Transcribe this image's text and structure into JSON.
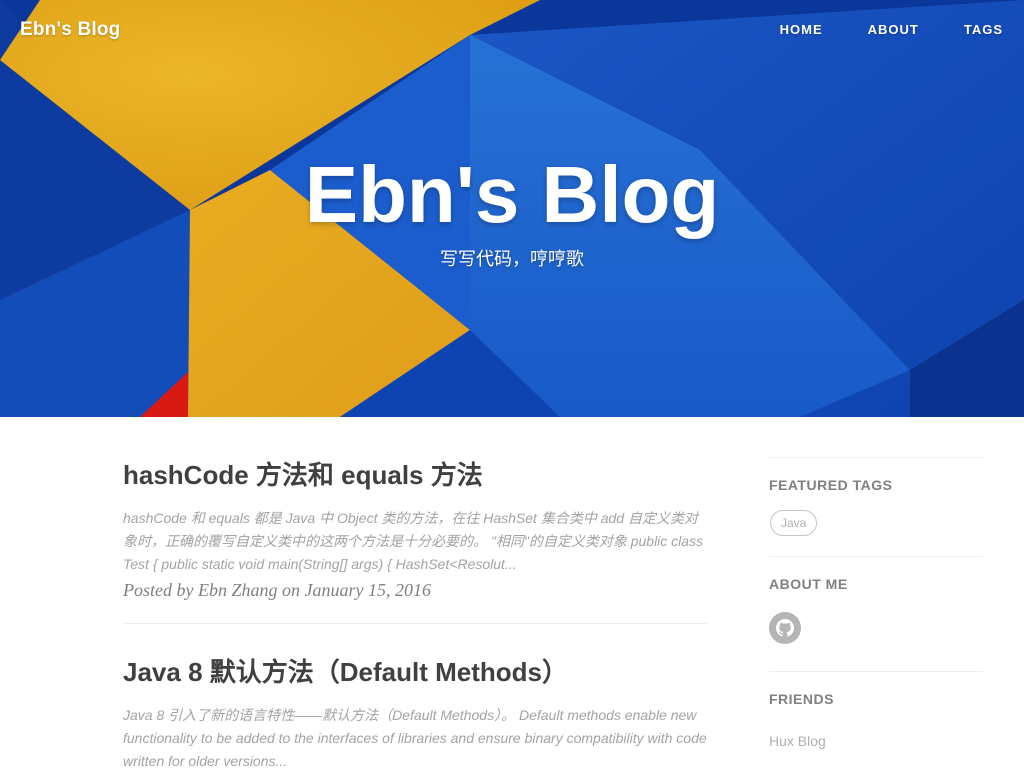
{
  "site": {
    "brand": "Ebn's Blog",
    "nav": [
      {
        "label": "HOME"
      },
      {
        "label": "ABOUT"
      },
      {
        "label": "TAGS"
      }
    ],
    "hero_title": "Ebn's Blog",
    "hero_subtitle": "写写代码，哼哼歌"
  },
  "posts": [
    {
      "title": "hashCode 方法和 equals 方法",
      "excerpt": "hashCode 和 equals 都是 Java 中 Object 类的方法，在往 HashSet 集合类中 add 自定义类对象时，正确的覆写自定义类中的这两个方法是十分必要的。 \"相同\"的自定义类对象 public class Test { public static void main(String[] args) { HashSet<Resolut...",
      "meta": "Posted by Ebn Zhang on January 15, 2016"
    },
    {
      "title": "Java 8 默认方法（Default Methods）",
      "excerpt": "Java 8 引入了新的语言特性——默认方法（Default Methods）。 Default methods enable new functionality to be added to the interfaces of libraries and ensure binary compatibility with code written for older versions..."
    }
  ],
  "sidebar": {
    "featured_tags_heading": "FEATURED TAGS",
    "tags": [
      "Java"
    ],
    "about_heading": "ABOUT ME",
    "social_icon": "github-icon",
    "friends_heading": "FRIENDS",
    "friends": [
      "Hux Blog"
    ]
  },
  "colors": {
    "hero_blue_dark": "#0d3aa3",
    "hero_blue_mid": "#1a5fd6",
    "hero_blue_light": "#2877e0",
    "hero_yellow": "#f3b222",
    "hero_red": "#e51c14"
  }
}
